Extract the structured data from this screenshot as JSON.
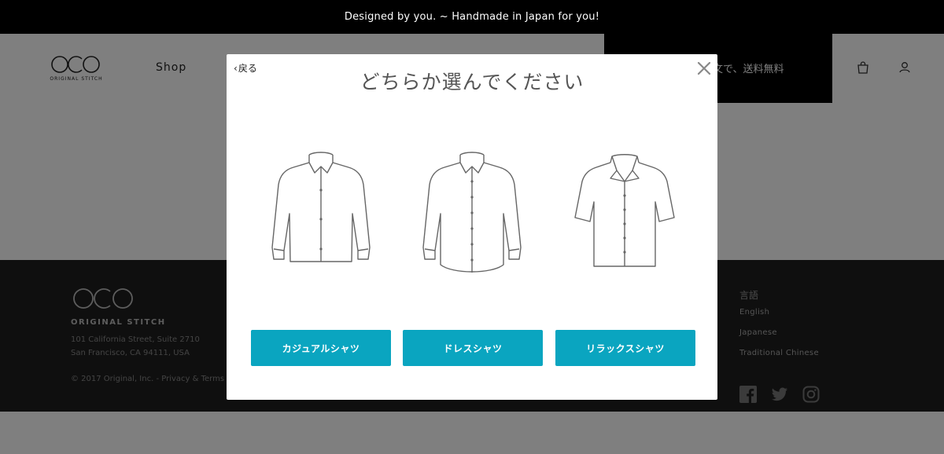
{
  "announcement": "Designed by you. ~ Handmade in Japan for you!",
  "header": {
    "logo_text": "ORIGINAL STITCH",
    "nav_shop": "Shop",
    "promo_text": "文で、送料無料"
  },
  "footer": {
    "brand": "ORIGINAL STITCH",
    "address_line1": "101 California Street, Suite 2710",
    "address_line2": "San Francisco, CA 94111, USA",
    "copyright": "© 2017 Original, Inc. - Privacy & Terms",
    "language_heading": "言語",
    "languages": [
      "English",
      "Japanese",
      "Traditional Chinese"
    ],
    "social_icons": [
      "facebook-icon",
      "twitter-icon",
      "instagram-icon"
    ]
  },
  "modal": {
    "back_label": "戻る",
    "title": "どちらか選んでください",
    "options": [
      {
        "label": "カジュアルシャツ",
        "icon": "casual-shirt-icon"
      },
      {
        "label": "ドレスシャツ",
        "icon": "dress-shirt-icon"
      },
      {
        "label": "リラックスシャツ",
        "icon": "relax-shirt-icon"
      }
    ]
  },
  "colors": {
    "accent": "#0aa5c0",
    "overlay": "rgba(0,0,0,0.5)",
    "footer_bg": "#1f1f1f",
    "announcement_bg": "#000000"
  }
}
